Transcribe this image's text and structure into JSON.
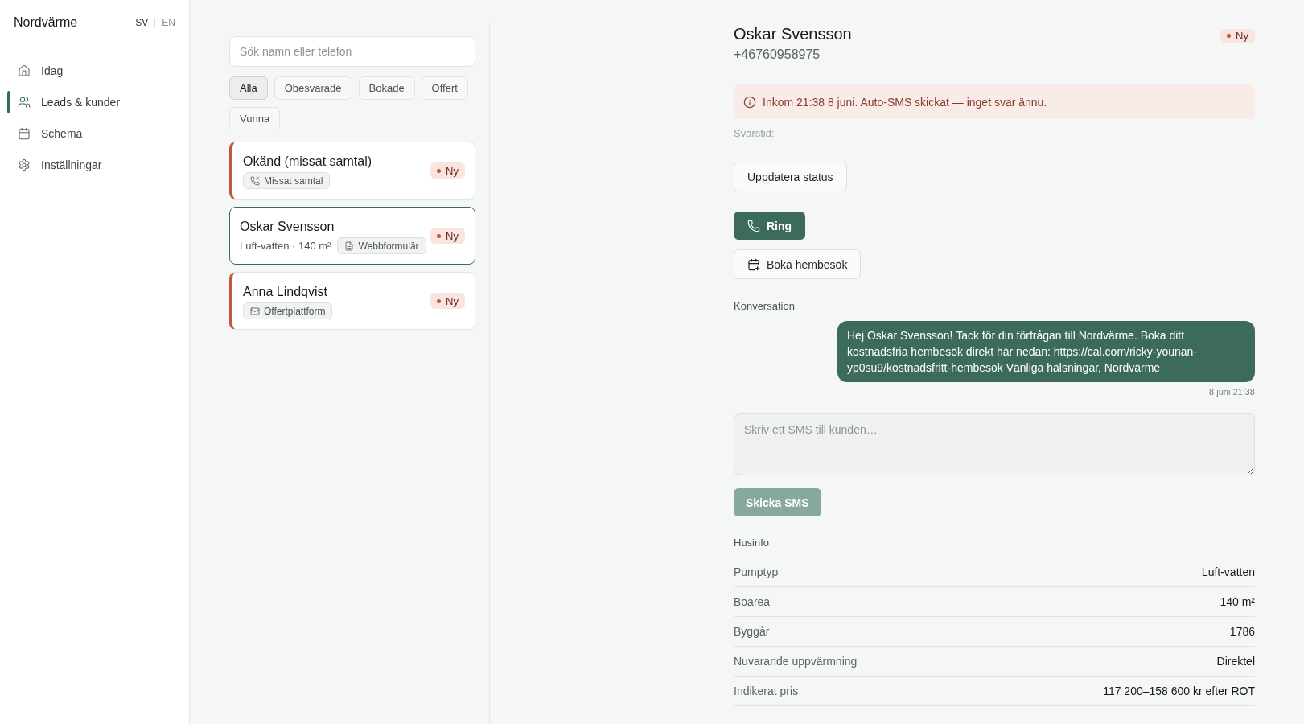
{
  "sidebar": {
    "brand": "Nordvärme",
    "languages": [
      {
        "label": "SV",
        "selected": true
      },
      {
        "label": "EN",
        "selected": false
      }
    ],
    "items": [
      {
        "label": "Idag",
        "selected": false
      },
      {
        "label": "Leads & kunder",
        "selected": true
      },
      {
        "label": "Schema",
        "selected": false
      },
      {
        "label": "Inställningar",
        "selected": false
      }
    ]
  },
  "lead_list": {
    "search": {
      "placeholder": "Sök namn eller telefon"
    },
    "filters": [
      {
        "label": "Alla",
        "selected": true
      },
      {
        "label": "Obesvarade",
        "selected": false
      },
      {
        "label": "Bokade",
        "selected": false
      },
      {
        "label": "Offert",
        "selected": false
      },
      {
        "label": "Vunna",
        "selected": false
      }
    ],
    "leads": [
      {
        "name": "Okänd (missat samtal)",
        "source": "Missat samtal",
        "status": "Ny",
        "selected": false
      },
      {
        "name": "Oskar Svensson",
        "details": "Luft-vatten · 140 m²",
        "source": "Webbformulär",
        "status": "Ny",
        "selected": true
      },
      {
        "name": "Anna Lindqvist",
        "source": "Offertplattform",
        "status": "Ny",
        "selected": false
      }
    ]
  },
  "lead_detail": {
    "name": "Oskar Svensson",
    "phone": "+46760958975",
    "status": "Ny",
    "alert": "Inkom 21:38 8 juni. Auto-SMS skickat — inget svar ännu.",
    "response_time": "Svarstid: —",
    "actions": [
      {
        "label": "Uppdatera status",
        "kind": "outline"
      },
      {
        "label": "Ring",
        "kind": "primary"
      },
      {
        "label": "Boka hembesök",
        "kind": "outline"
      }
    ],
    "conversation": {
      "title": "Konversation",
      "messages": [
        {
          "kind": "outgoing",
          "text": "Hej Oskar Svensson! Tack för din förfrågan till Nordvärme. Boka ditt kostnadsfria hembesök direkt här nedan: https://cal.com/ricky-younan-yp0su9/kostnadsfritt-hembesok Vänliga hälsningar, Nordvärme",
          "time": "8 juni 21:38"
        }
      ],
      "compose": {
        "placeholder": "Skriv ett SMS till kunden…"
      },
      "send_button": {
        "label": "Skicka SMS",
        "disabled": true
      }
    },
    "house_info": {
      "title": "Husinfo",
      "rows": [
        {
          "label": "Pumptyp",
          "value": "Luft-vatten"
        },
        {
          "label": "Boarea",
          "value": "140 m²"
        },
        {
          "label": "Byggår",
          "value": "1786"
        },
        {
          "label": "Nuvarande uppvärmning",
          "value": "Direktel"
        },
        {
          "label": "Indikerat pris",
          "value": "117 200–158 600 kr efter ROT"
        }
      ]
    }
  }
}
